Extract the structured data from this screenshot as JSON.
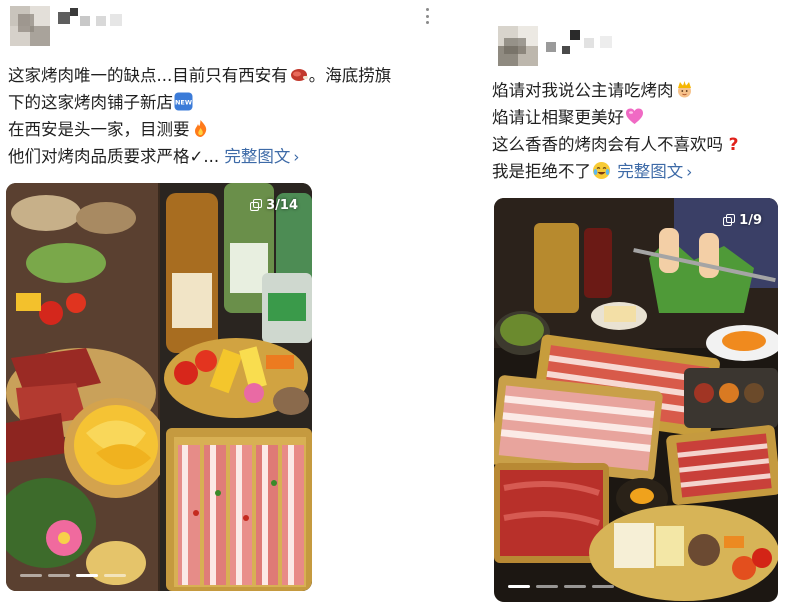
{
  "posts": [
    {
      "text_lines": [
        "这家烤肉唯一的缺点...目前只有西安有",
        "。海底捞旗",
        "下的这家烤肉铺子新店",
        "在西安是头一家，目测要",
        "他们对烤肉品质要求严格✓..."
      ],
      "full_text_link": "完整图文",
      "emoji_names": [
        "meat-emoji",
        "new-badge-emoji",
        "fire-emoji"
      ],
      "image_counter": "3/14",
      "image_description": "food photo collage: grilled meat platter, mango, drinks bottles, vegetables and sliced pork belly",
      "carousel_dots": 4,
      "carousel_active_dot": 2
    },
    {
      "text_lines": [
        "焰请对我说公主请吃烤肉",
        "焰请让相聚更美好",
        "这么香香的烤肉会有人不喜欢吗",
        "我是拒绝不了"
      ],
      "full_text_link": "完整图文",
      "emoji_names": [
        "princess-emoji",
        "pink-heart-emoji",
        "red-question-emoji",
        "crying-laugh-emoji"
      ],
      "image_counter": "1/9",
      "image_description": "barbecue table spread with trays of sliced pork belly and beef, vegetables, sauces and hands holding tongs",
      "carousel_dots": 4,
      "carousel_active_dot": 0
    }
  ],
  "colors": {
    "link": "#3d6aa7",
    "text": "#1f1f1f",
    "more_icon": "#8a8a8a"
  }
}
